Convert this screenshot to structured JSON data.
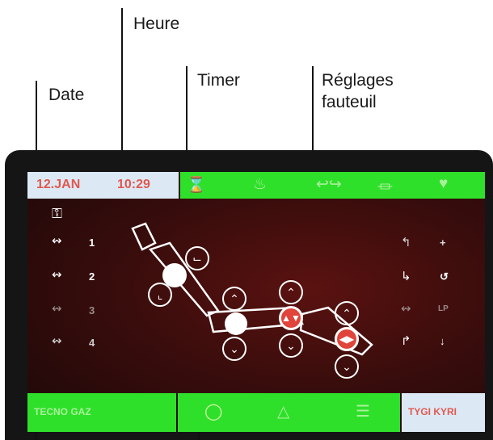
{
  "callouts": {
    "heure": "Heure",
    "timer": "Timer",
    "date": "Date",
    "reglages_line1": "Réglages",
    "reglages_line2": "fauteuil"
  },
  "topbar": {
    "date": "12.JAN",
    "time": "10:29",
    "icons": [
      "hourglass-icon",
      "spittoon-icon",
      "chair-move-icon",
      "cup-fill-icon",
      "cup-icon"
    ]
  },
  "left_panel": {
    "items": [
      {
        "icon": "key-icon",
        "label": ""
      },
      {
        "icon": "chair-preset-icon",
        "label": "1"
      },
      {
        "icon": "chair-preset-icon",
        "label": "2"
      },
      {
        "icon": "chair-preset-icon",
        "label": "3"
      },
      {
        "icon": "chair-preset-icon",
        "label": "4"
      }
    ]
  },
  "right_panel": {
    "items": [
      {
        "icon": "chair-up-icon",
        "label": "+"
      },
      {
        "icon": "chair-return-icon",
        "label": "↺"
      },
      {
        "icon": "chair-lp-icon",
        "label": "LP"
      },
      {
        "icon": "chair-down-icon",
        "label": "↓"
      }
    ]
  },
  "bottombar": {
    "brand": "TECNO GAZ",
    "right_label": "TYGI KYRI",
    "icons": [
      "lightbulb-icon",
      "lamp-icon",
      "list-icon"
    ]
  },
  "colors": {
    "accent_green": "#2fe02a",
    "label_red": "#e0584e",
    "panel_light": "#dce9f5",
    "screen_bg": "#3a0d0c"
  }
}
